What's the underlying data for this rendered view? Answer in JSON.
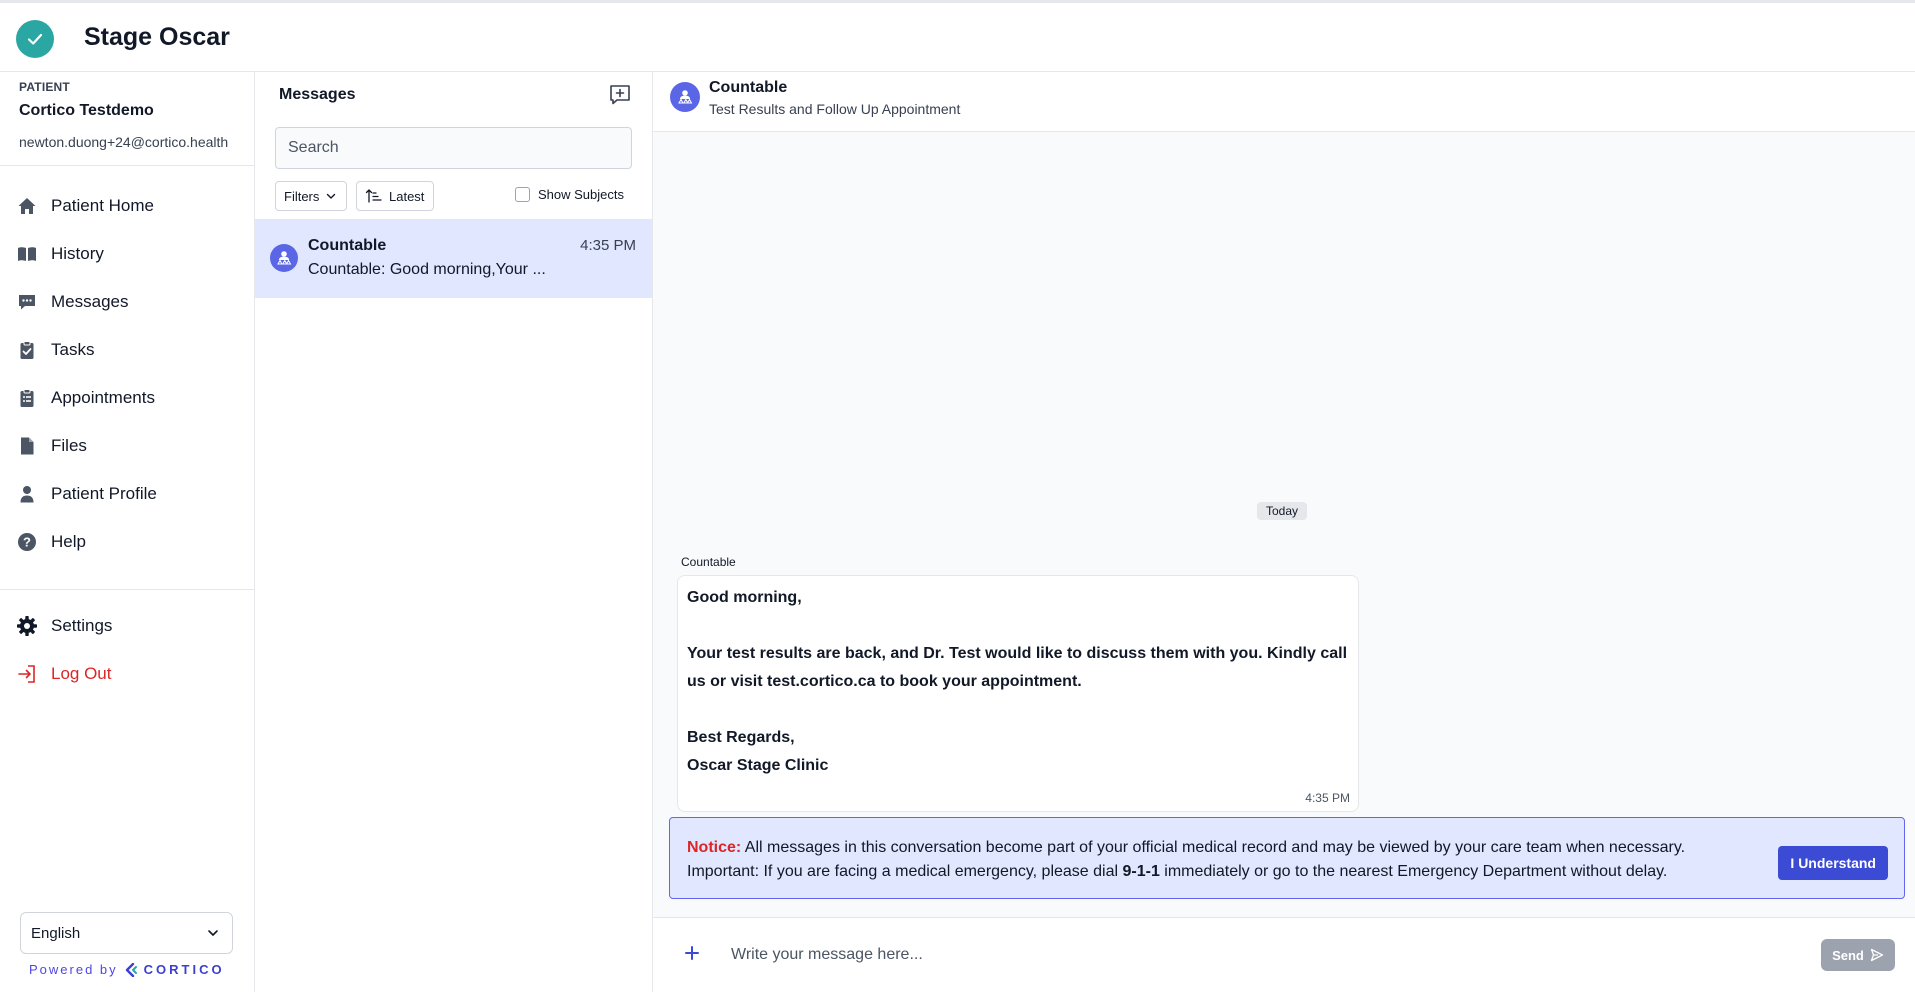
{
  "app": {
    "title": "Stage Oscar"
  },
  "patient": {
    "label": "PATIENT",
    "name": "Cortico Testdemo",
    "email": "newton.duong+24@cortico.health"
  },
  "nav": {
    "items": [
      {
        "label": "Patient Home",
        "icon": "home-icon"
      },
      {
        "label": "History",
        "icon": "book-icon"
      },
      {
        "label": "Messages",
        "icon": "chat-icon"
      },
      {
        "label": "Tasks",
        "icon": "clipboard-check-icon"
      },
      {
        "label": "Appointments",
        "icon": "clipboard-list-icon"
      },
      {
        "label": "Files",
        "icon": "file-icon"
      },
      {
        "label": "Patient Profile",
        "icon": "user-icon"
      },
      {
        "label": "Help",
        "icon": "question-icon"
      }
    ],
    "settings_label": "Settings",
    "logout_label": "Log Out"
  },
  "language": {
    "selected": "English"
  },
  "powered": {
    "prefix": "Powered by",
    "brand": "CORTICO"
  },
  "messages_panel": {
    "title": "Messages",
    "search_placeholder": "Search",
    "filters_label": "Filters",
    "sort_label": "Latest",
    "show_subjects_label": "Show Subjects",
    "conversations": [
      {
        "name": "Countable",
        "time": "4:35 PM",
        "preview": "Countable: Good morning,Your ..."
      }
    ]
  },
  "conversation": {
    "name": "Countable",
    "subject": "Test Results and Follow Up Appointment",
    "date_divider": "Today",
    "message": {
      "sender": "Countable",
      "text": "Good morning,\n\nYour test results are back, and Dr. Test would like to discuss them with you. Kindly call us or visit test.cortico.ca to book your appointment.\n\nBest Regards,\nOscar Stage Clinic",
      "time": "4:35 PM"
    },
    "notice": {
      "label": "Notice:",
      "line1": " All messages in this conversation become part of your official medical record and may be viewed by your care team when necessary.",
      "line2_before": "Important: If you are facing a medical emergency, please dial ",
      "line2_strong": "9-1-1",
      "line2_after": " immediately or go to the nearest Emergency Department without delay.",
      "button": "I Understand"
    },
    "composer": {
      "placeholder": "Write your message here...",
      "send_label": "Send"
    }
  },
  "colors": {
    "accent": "#3b4bd4",
    "brand_teal": "#2aa7a3",
    "selected_bg": "#e0e7ff",
    "danger": "#dc2626"
  }
}
